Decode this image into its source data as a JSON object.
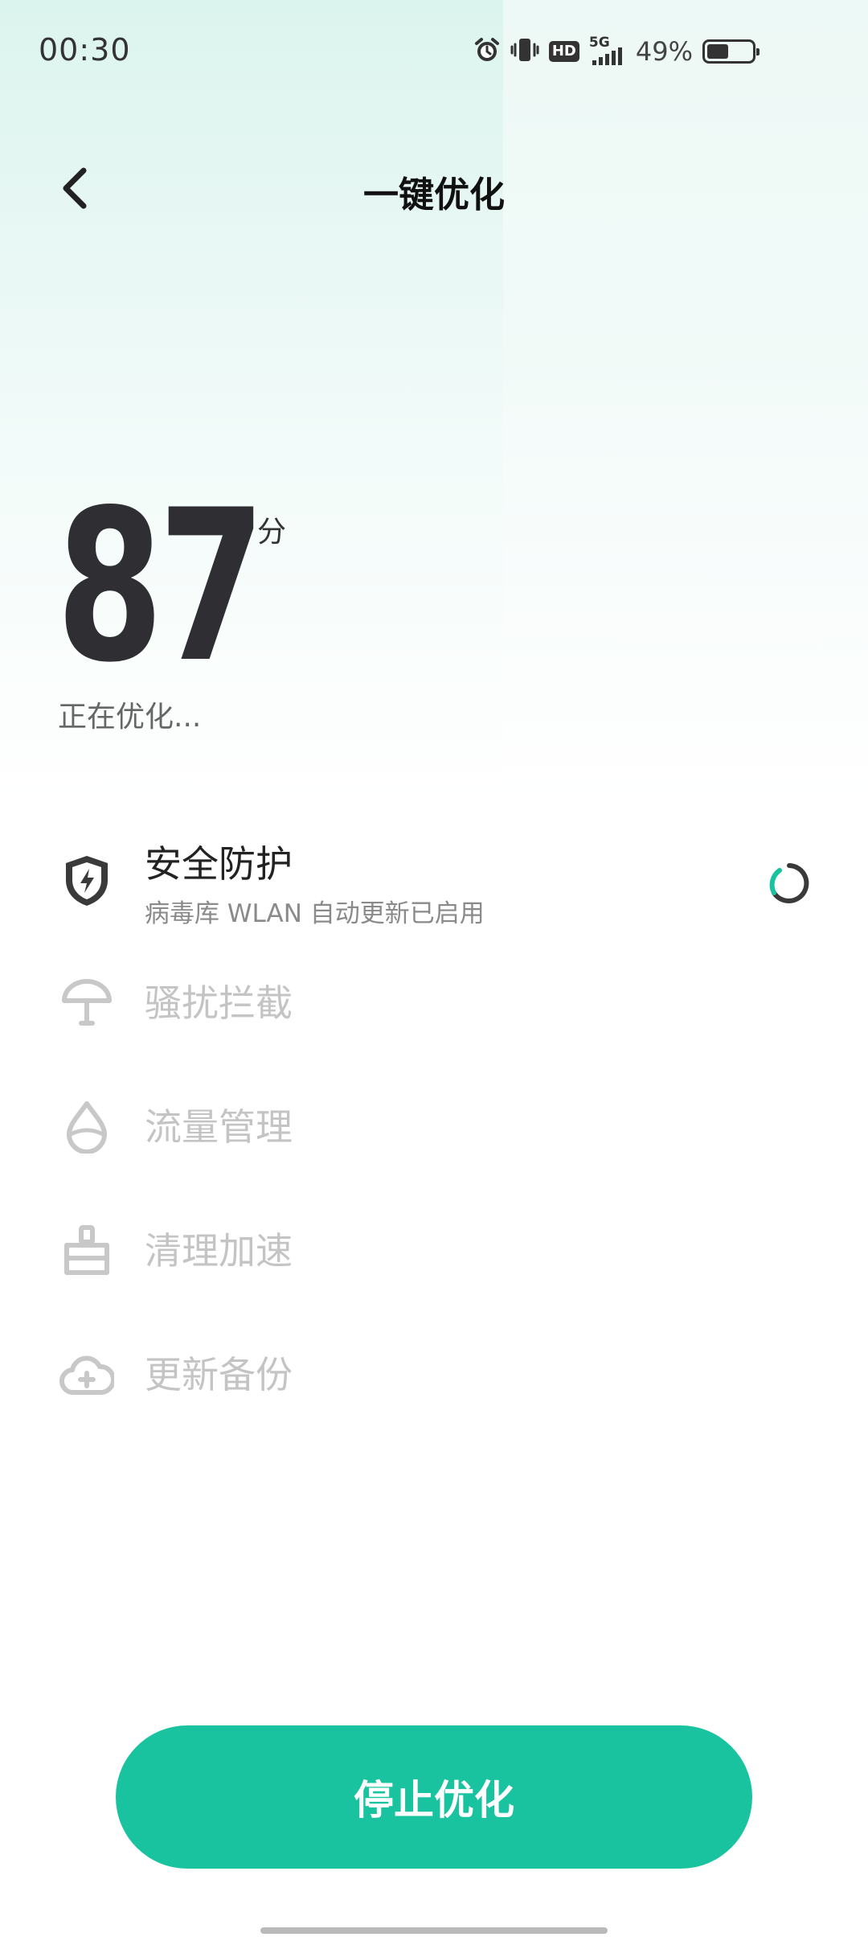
{
  "status_bar": {
    "time": "00:30",
    "network_label": "5G",
    "hd_label": "HD",
    "battery_percent": "49%",
    "battery_level": 0.49
  },
  "header": {
    "title": "一键优化"
  },
  "score": {
    "value": "87",
    "unit": "分",
    "status_text": "正在优化..."
  },
  "items": [
    {
      "title": "安全防护",
      "subtitle": "病毒库 WLAN 自动更新已启用",
      "icon": "shield-bolt-icon",
      "state": "in-progress"
    },
    {
      "title": "骚扰拦截",
      "icon": "umbrella-icon",
      "state": "pending"
    },
    {
      "title": "流量管理",
      "icon": "droplet-icon",
      "state": "pending"
    },
    {
      "title": "清理加速",
      "icon": "broom-icon",
      "state": "pending"
    },
    {
      "title": "更新备份",
      "icon": "cloud-plus-icon",
      "state": "pending"
    }
  ],
  "colors": {
    "accent": "#19c39f",
    "text_dark": "#222222",
    "text_disabled": "#c4c4c4"
  },
  "footer": {
    "stop_label": "停止优化"
  }
}
